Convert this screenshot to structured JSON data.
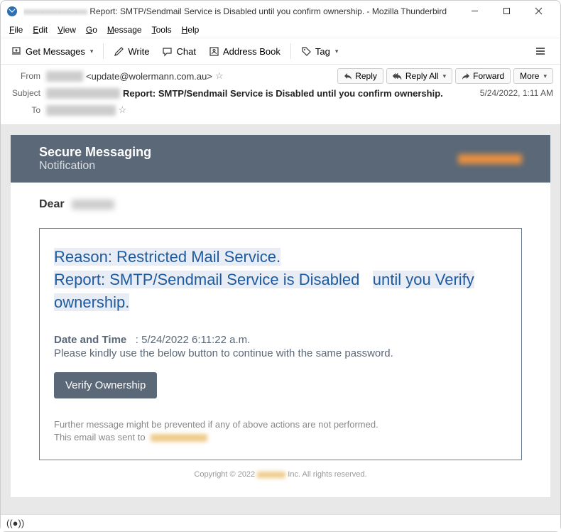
{
  "window": {
    "title_prefix_redacted": "xxxxxxxxxxxxxx",
    "title": "Report: SMTP/Sendmail Service is Disabled until you confirm ownership. - Mozilla Thunderbird"
  },
  "menu": {
    "file": "File",
    "edit": "Edit",
    "view": "View",
    "go": "Go",
    "message": "Message",
    "tools": "Tools",
    "help": "Help"
  },
  "toolbar": {
    "get_messages": "Get Messages",
    "write": "Write",
    "chat": "Chat",
    "address_book": "Address Book",
    "tag": "Tag"
  },
  "headers": {
    "from_label": "From",
    "from_email": "<update@wolermann.com.au>",
    "subject_label": "Subject",
    "subject_text": "Report: SMTP/Sendmail Service is Disabled until you confirm ownership.",
    "to_label": "To",
    "timestamp": "5/24/2022, 1:11 AM",
    "reply": "Reply",
    "reply_all": "Reply All",
    "forward": "Forward",
    "more": "More"
  },
  "message": {
    "banner_title": "Secure Messaging",
    "banner_subtitle": "Notification",
    "dear": "Dear",
    "reason_line": "Reason: Restricted Mail Service.",
    "report_line_a": "Report: SMTP/Sendmail Service is Disabled",
    "report_line_b": "until you Verify ownership.",
    "date_label": "Date and Time",
    "date_value": ": 5/24/2022 6:11:22 a.m.",
    "instruction": "Please kindly use the below button to continue with the same password.",
    "verify_button": "Verify Ownership",
    "footer1": "Further message might be prevented if any of above actions are not performed.",
    "footer2": "This email was sent to",
    "copyright_left": "Copyright © 2022",
    "copyright_right": "Inc. All rights reserved."
  }
}
